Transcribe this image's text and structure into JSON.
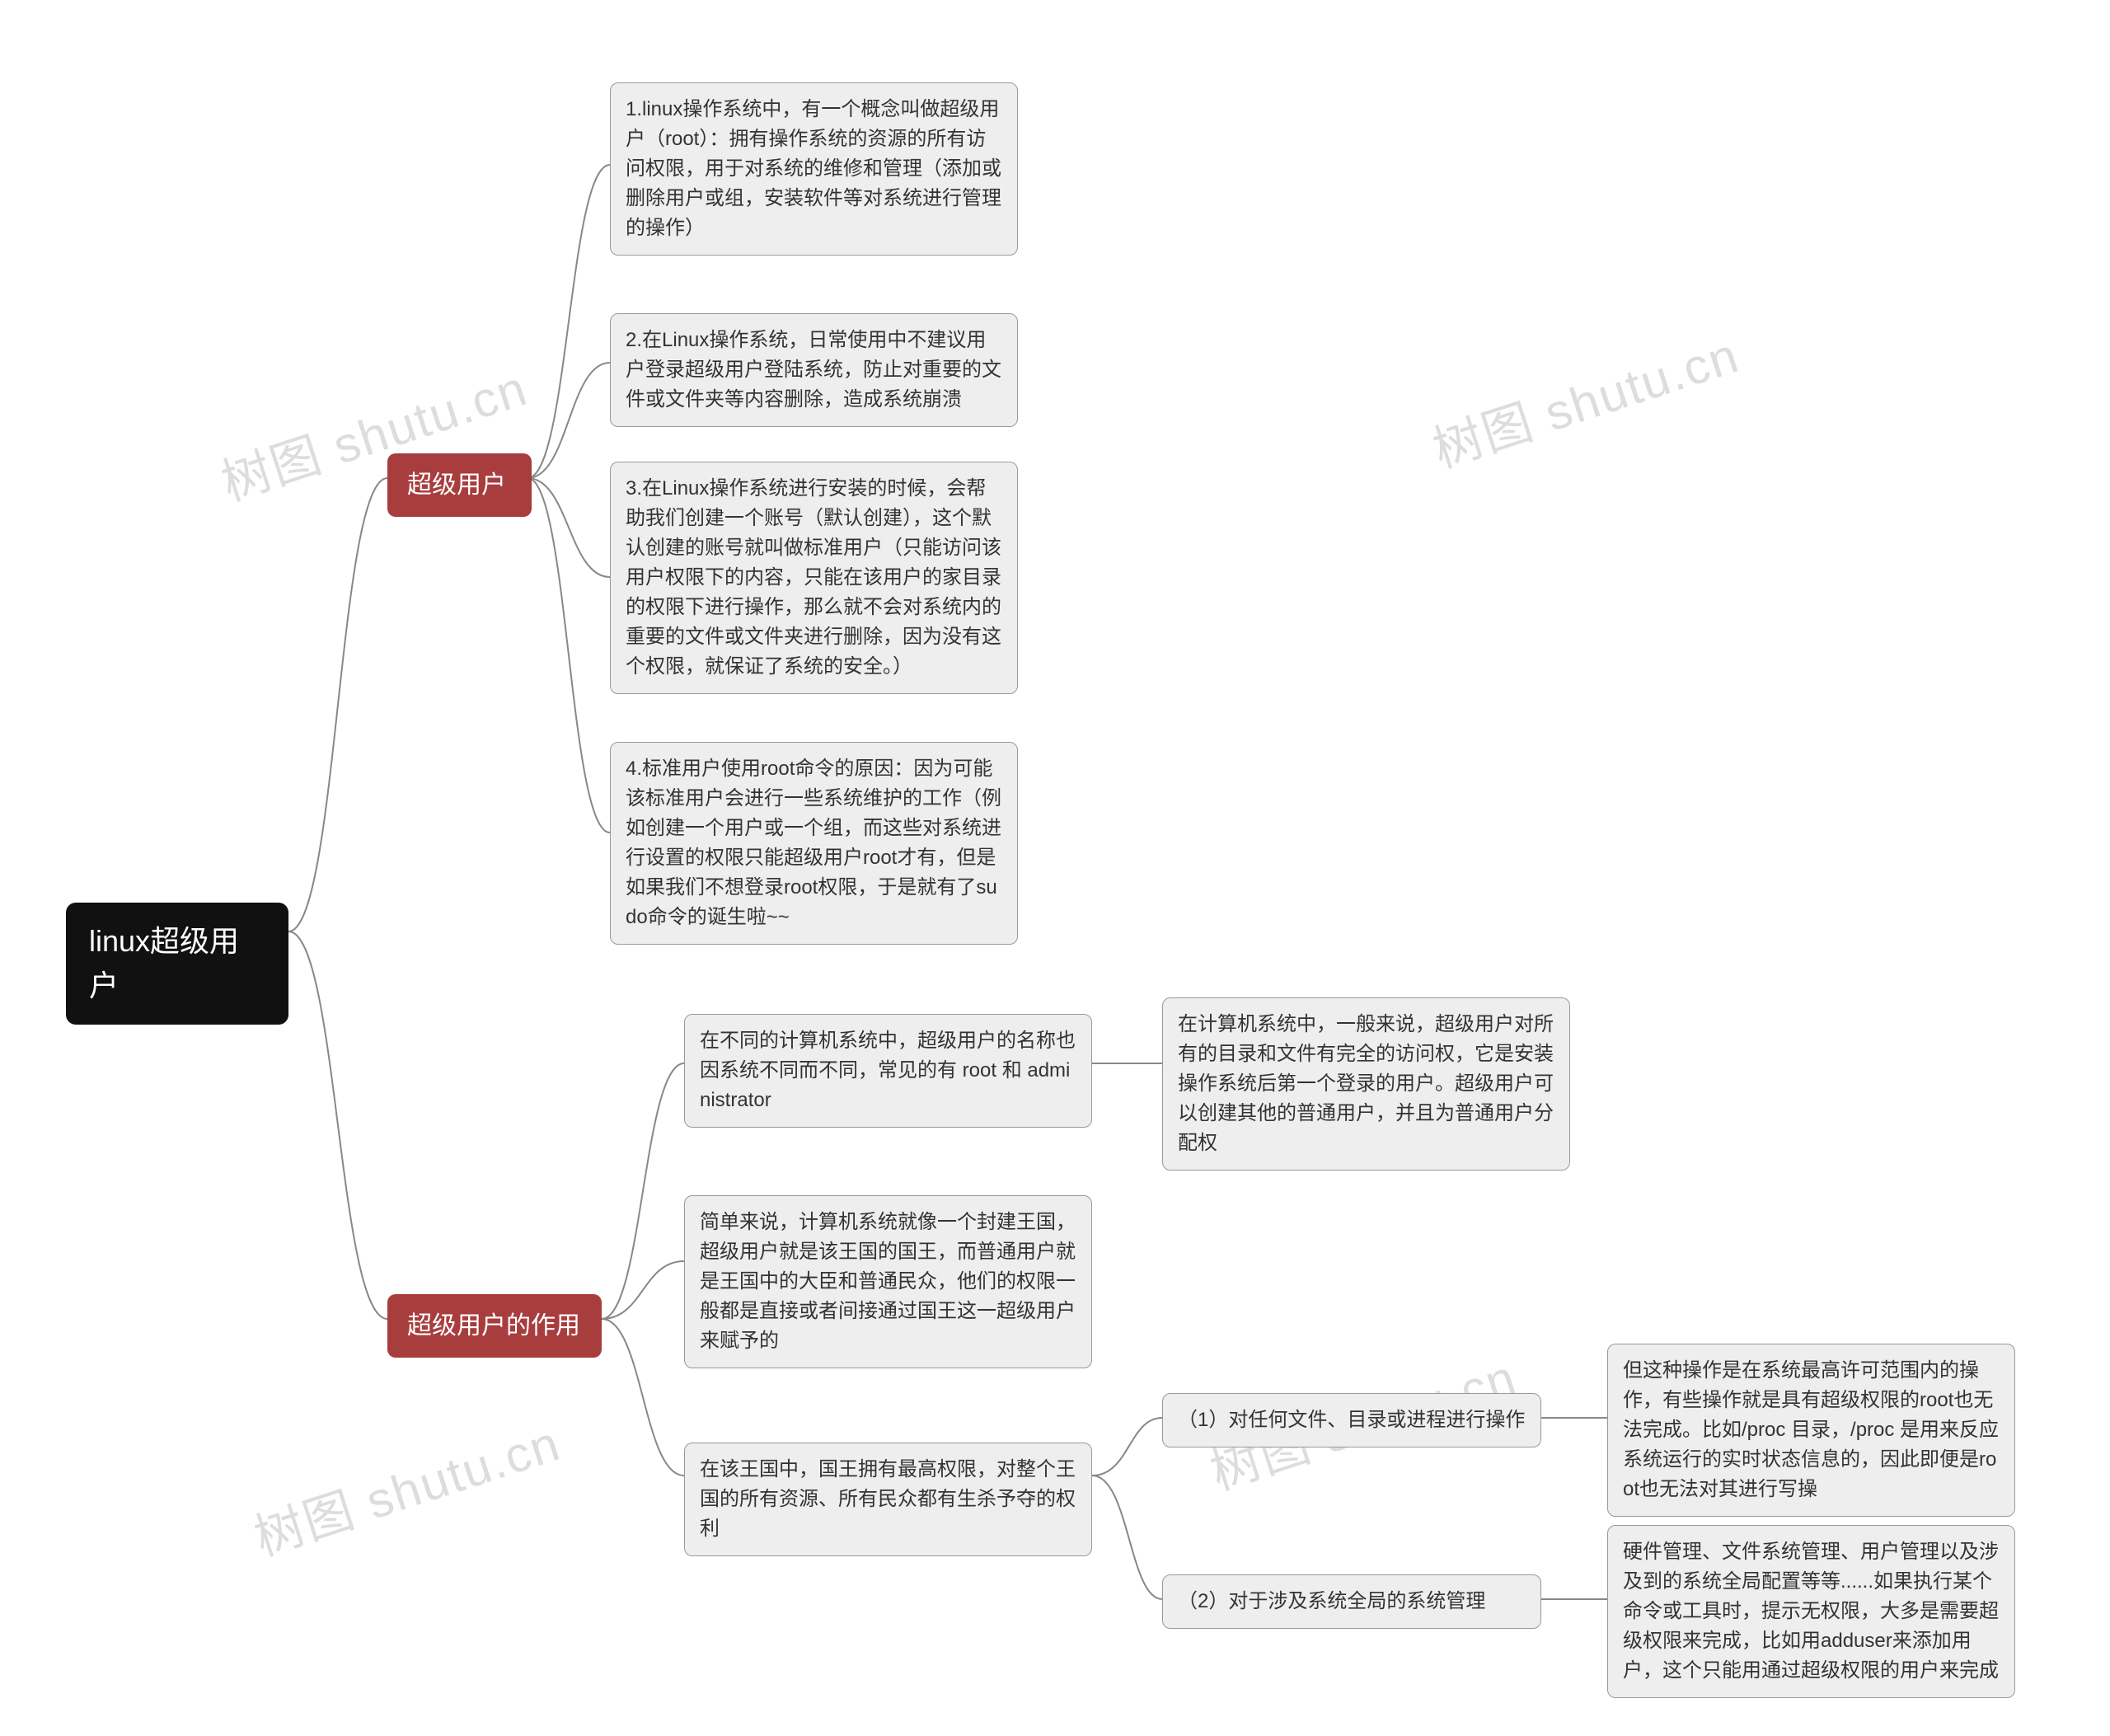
{
  "root": {
    "label": "linux超级用户"
  },
  "branch1": {
    "label": "超级用户"
  },
  "branch2": {
    "label": "超级用户的作用"
  },
  "b1_leaf1": "1.linux操作系统中，有一个概念叫做超级用户（root）：拥有操作系统的资源的所有访问权限，用于对系统的维修和管理（添加或删除用户或组，安装软件等对系统进行管理的操作）",
  "b1_leaf2": "2.在Linux操作系统，日常使用中不建议用户登录超级用户登陆系统，防止对重要的文件或文件夹等内容删除，造成系统崩溃",
  "b1_leaf3": "3.在Linux操作系统进行安装的时候，会帮助我们创建一个账号（默认创建），这个默认创建的账号就叫做标准用户（只能访问该用户权限下的内容，只能在该用户的家目录的权限下进行操作，那么就不会对系统内的重要的文件或文件夹进行删除，因为没有这个权限，就保证了系统的安全。）",
  "b1_leaf4": "4.标准用户使用root命令的原因：因为可能该标准用户会进行一些系统维护的工作（例如创建一个用户或一个组，而这些对系统进行设置的权限只能超级用户root才有，但是如果我们不想登录root权限，于是就有了sudo命令的诞生啦~~",
  "b2_leaf1": "在不同的计算机系统中，超级用户的名称也因系统不同而不同，常见的有 root 和 administrator",
  "b2_leaf1_1": "在计算机系统中，一般来说，超级用户对所有的目录和文件有完全的访问权，它是安装操作系统后第一个登录的用户。超级用户可以创建其他的普通用户，并且为普通用户分配权",
  "b2_leaf2": "简单来说，计算机系统就像一个封建王国，超级用户就是该王国的国王，而普通用户就是王国中的大臣和普通民众，他们的权限一般都是直接或者间接通过国王这一超级用户来赋予的",
  "b2_leaf3": "在该王国中，国王拥有最高权限，对整个王国的所有资源、所有民众都有生杀予夺的权利",
  "b2_leaf3_1": "（1）对任何文件、目录或进程进行操作",
  "b2_leaf3_1_1": "但这种操作是在系统最高许可范围内的操作，有些操作就是具有超级权限的root也无法完成。比如/proc 目录，/proc 是用来反应系统运行的实时状态信息的，因此即便是root也无法对其进行写操",
  "b2_leaf3_2": "（2）对于涉及系统全局的系统管理",
  "b2_leaf3_2_1": "硬件管理、文件系统管理、用户管理以及涉及到的系统全局配置等等......如果执行某个命令或工具时，提示无权限，大多是需要超级权限来完成，比如用adduser来添加用户，这个只能用通过超级权限的用户来完成",
  "watermark": "树图 shutu.cn"
}
